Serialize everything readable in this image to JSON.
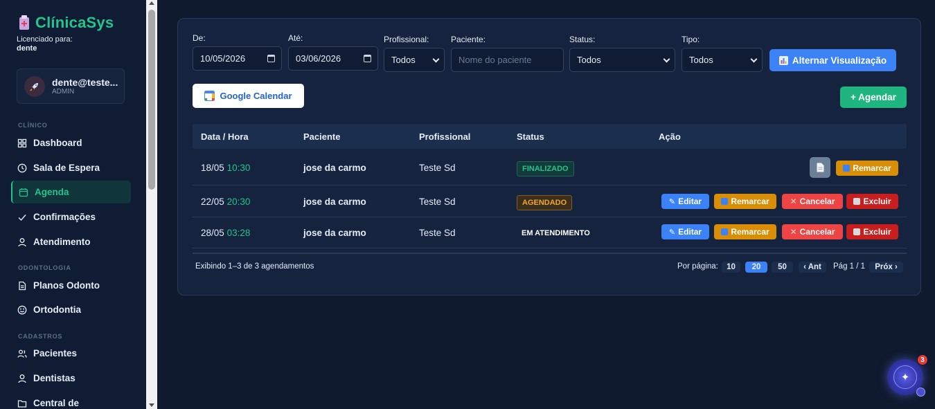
{
  "brand": {
    "name": "ClínicaSys",
    "licensed_label": "Licenciado para:",
    "licensed_to": "dente"
  },
  "user": {
    "name": "dente@teste...",
    "role": "ADMIN"
  },
  "sidebar": {
    "sections": [
      "CLÍNICO",
      "ODONTOLOGIA",
      "CADASTROS"
    ],
    "items": [
      {
        "label": "Dashboard",
        "icon": "grid-icon"
      },
      {
        "label": "Sala de Espera",
        "icon": "clock-icon"
      },
      {
        "label": "Agenda",
        "icon": "calendar-icon",
        "active": true
      },
      {
        "label": "Confirmações",
        "icon": "check-icon"
      },
      {
        "label": "Atendimento",
        "icon": "user-icon"
      },
      {
        "label": "Planos Odonto",
        "icon": "document-icon"
      },
      {
        "label": "Ortodontia",
        "icon": "smile-icon"
      },
      {
        "label": "Pacientes",
        "icon": "users-icon"
      },
      {
        "label": "Dentistas",
        "icon": "user-icon"
      },
      {
        "label": "Central de",
        "icon": "folder-icon"
      }
    ]
  },
  "filters": {
    "de_label": "De:",
    "de_value": "10/05/2026",
    "ate_label": "Até:",
    "ate_value": "03/06/2026",
    "profissional_label": "Profissional:",
    "profissional_value": "Todos",
    "paciente_label": "Paciente:",
    "paciente_placeholder": "Nome do paciente",
    "status_label": "Status:",
    "status_value": "Todos",
    "tipo_label": "Tipo:",
    "tipo_value": "Todos",
    "toggle_view_label": "Alternar Visualização"
  },
  "actions": {
    "google_calendar_label": "Google Calendar",
    "agendar_label": "+ Agendar"
  },
  "table": {
    "headers": [
      "Data / Hora",
      "Paciente",
      "Profissional",
      "Status",
      "Ação"
    ],
    "rows": [
      {
        "date": "18/05",
        "time": "10:30",
        "patient": "jose da carmo",
        "professional": "Teste Sd",
        "status": "FINALIZADO"
      },
      {
        "date": "22/05",
        "time": "20:30",
        "patient": "jose da carmo",
        "professional": "Teste Sd",
        "status": "AGENDADO"
      },
      {
        "date": "28/05",
        "time": "03:28",
        "patient": "jose da carmo",
        "professional": "Teste Sd",
        "status": "EM ATENDIMENTO"
      }
    ],
    "action_labels": {
      "edit": "Editar",
      "remarcar": "Remarcar",
      "cancel": "Cancelar",
      "delete": "Excluir"
    }
  },
  "pagination": {
    "summary": "Exibindo 1–3 de 3 agendamentos",
    "per_page_label": "Por página:",
    "per_page_options": [
      "10",
      "20",
      "50"
    ],
    "per_page_selected": "20",
    "prev_label": "‹ Ant",
    "page_info": "Pág 1 / 1",
    "next_label": "Próx ›"
  },
  "assistant": {
    "badge_count": "3"
  },
  "colors": {
    "accent": "#22c58b",
    "primary": "#3b82f6",
    "warning": "#d98e06",
    "danger": "#ef4444"
  }
}
